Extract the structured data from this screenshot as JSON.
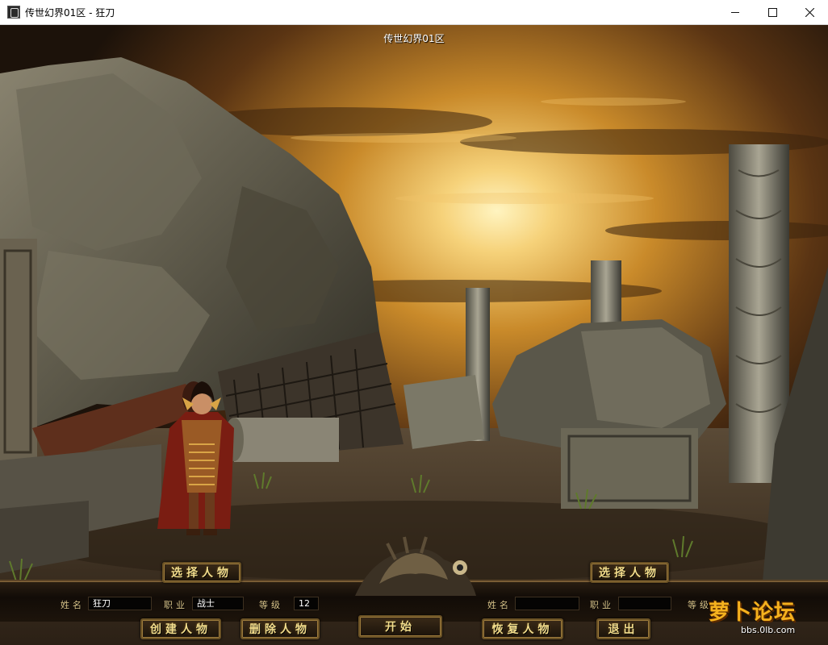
{
  "window": {
    "title": "传世幻界01区 - 狂刀",
    "icon": "app-icon",
    "controls": [
      "minimize-icon",
      "maximize-icon",
      "close-icon"
    ]
  },
  "scene": {
    "server_label": "传世幻界01区",
    "sky_color": "#c98a2a",
    "stone_color": "#6e6a5c"
  },
  "panel": {
    "left": {
      "select_button": "选择人物",
      "name_label": "姓名",
      "name_value": "狂刀",
      "job_label": "职业",
      "job_value": "战士",
      "level_label": "等级",
      "level_value": "12"
    },
    "right": {
      "select_button": "选择人物",
      "name_label": "姓名",
      "name_value": "",
      "job_label": "职业",
      "job_value": "",
      "level_label": "等级"
    },
    "buttons": {
      "create": "创建人物",
      "delete": "删除人物",
      "start": "开始",
      "restore": "恢复人物",
      "exit": "退出"
    }
  },
  "watermark": {
    "main": "萝卜论坛",
    "sub": "bbs.0lb.com"
  },
  "colors": {
    "button_text": "#f3dd8c",
    "label_text": "#d9c48a",
    "panel_border": "#5d4527"
  }
}
